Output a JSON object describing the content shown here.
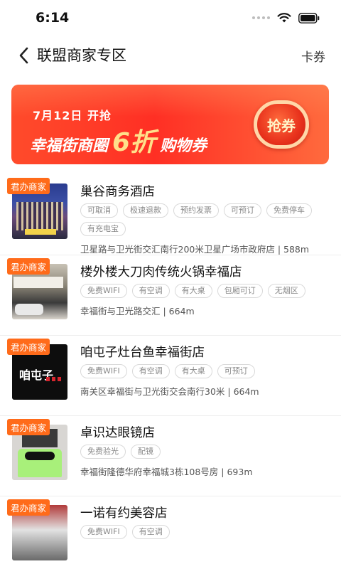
{
  "status_bar": {
    "time": "6:14"
  },
  "nav": {
    "title": "联盟商家专区",
    "right": "卡券"
  },
  "banner": {
    "date": "7月12日 开抢",
    "line_prefix": "幸福街商圈",
    "line_big": "6折",
    "line_suffix": "购物券",
    "button": "抢券",
    "colors": {
      "bg": "#ff3a28",
      "accent": "#ffe08a"
    }
  },
  "badge_label": "君办商家",
  "merchants": [
    {
      "name": "巢谷商务酒店",
      "tags": [
        "可取消",
        "极速退款",
        "预约发票",
        "可预订",
        "免费停车",
        "有充电宝"
      ],
      "address": "卫星路与卫光街交汇南行200米卫星广场市政府店 | 588m"
    },
    {
      "name": "楼外楼大刀肉传统火锅幸福店",
      "tags": [
        "免费WIFI",
        "有空调",
        "有大桌",
        "包厢可订",
        "无烟区"
      ],
      "address": "幸福街与卫光路交汇 | 664m"
    },
    {
      "name": "咱屯子灶台鱼幸福街店",
      "tags": [
        "免费WIFI",
        "有空调",
        "有大桌",
        "可预订"
      ],
      "address": "南关区幸福街与卫光街交会南行30米 | 664m"
    },
    {
      "name": "卓识达眼镜店",
      "tags": [
        "免费验光",
        "配镜"
      ],
      "address": "幸福街隆德华府幸福城3栋108号房 | 693m"
    },
    {
      "name": "一诺有约美容店",
      "tags": [
        "免费WIFI",
        "有空调"
      ],
      "address": ""
    }
  ]
}
